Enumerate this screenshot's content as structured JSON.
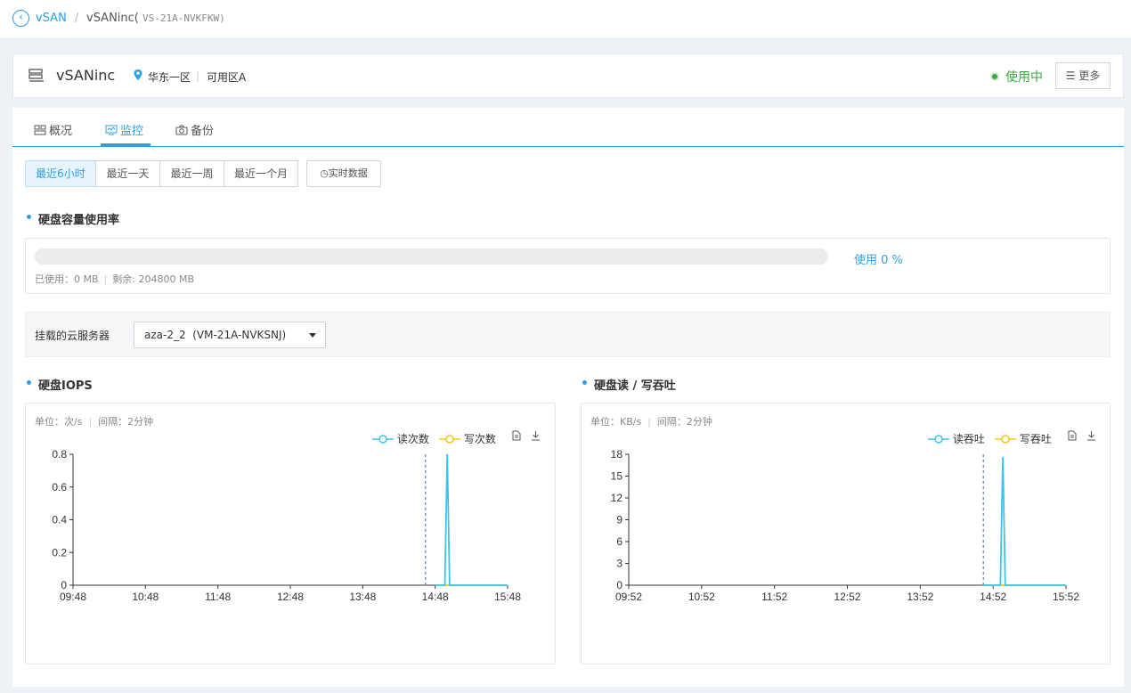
{
  "breadcrumb": {
    "back": "vSAN",
    "separator": "/",
    "current": "vSANinc(",
    "current_id": "VS-21A-NVKFKW)"
  },
  "header": {
    "title": "vSANinc",
    "region": "华东一区",
    "zone": "可用区A",
    "status": "使用中",
    "more_label": "☰ 更多",
    "status_color": "#39a83e"
  },
  "tabs": [
    {
      "label": "概况"
    },
    {
      "label": "监控"
    },
    {
      "label": "备份"
    }
  ],
  "ranges": [
    "最近6小时",
    "最近一天",
    "最近一周",
    "最近一个月"
  ],
  "realtime_label": "实时数据",
  "capacity": {
    "title": "硬盘容量使用率",
    "percent_text": "使用 0 %",
    "used_percent": 0,
    "used_text": "已使用：0 MB",
    "remain_text": "剩余: 204800 MB"
  },
  "server": {
    "label": "挂载的云服务器",
    "selected": "aza-2_2  (VM-21A-NVKSNJ)"
  },
  "chart_data": [
    {
      "type": "line",
      "title": "硬盘IOPS",
      "unit_text": "单位：次/s",
      "interval_text": "间隔：2分钟",
      "x": [
        "09:48",
        "10:48",
        "11:48",
        "12:48",
        "13:48",
        "14:48",
        "15:48"
      ],
      "y_ticks": [
        "0",
        "0.2",
        "0.4",
        "0.6",
        "0.8"
      ],
      "ylim": [
        0,
        0.8
      ],
      "marker_time": "14:40",
      "series": [
        {
          "name": "读次数",
          "color": "#3ec3ec",
          "points": [
            [
              "14:48",
              0
            ],
            [
              "14:56",
              0
            ],
            [
              "14:58",
              0.8
            ],
            [
              "15:00",
              0
            ],
            [
              "15:48",
              0
            ]
          ]
        },
        {
          "name": "写次数",
          "color": "#f5c518",
          "points": [
            [
              "14:48",
              0
            ],
            [
              "15:48",
              0
            ]
          ]
        }
      ]
    },
    {
      "type": "line",
      "title": "硬盘读 / 写吞吐",
      "unit_text": "单位：KB/s",
      "interval_text": "间隔：2分钟",
      "x": [
        "09:52",
        "10:52",
        "11:52",
        "12:52",
        "13:52",
        "14:52",
        "15:52"
      ],
      "y_ticks": [
        "0",
        "3",
        "6",
        "9",
        "12",
        "15",
        "18"
      ],
      "ylim": [
        0,
        18
      ],
      "marker_time": "14:44",
      "series": [
        {
          "name": "读吞吐",
          "color": "#3ec3ec",
          "points": [
            [
              "14:44",
              0
            ],
            [
              "14:58",
              0
            ],
            [
              "15:00",
              17.6
            ],
            [
              "15:02",
              0
            ],
            [
              "15:52",
              0
            ]
          ]
        },
        {
          "name": "写吞吐",
          "color": "#f5c518",
          "points": [
            [
              "14:44",
              0
            ],
            [
              "15:52",
              0
            ]
          ]
        }
      ]
    }
  ]
}
